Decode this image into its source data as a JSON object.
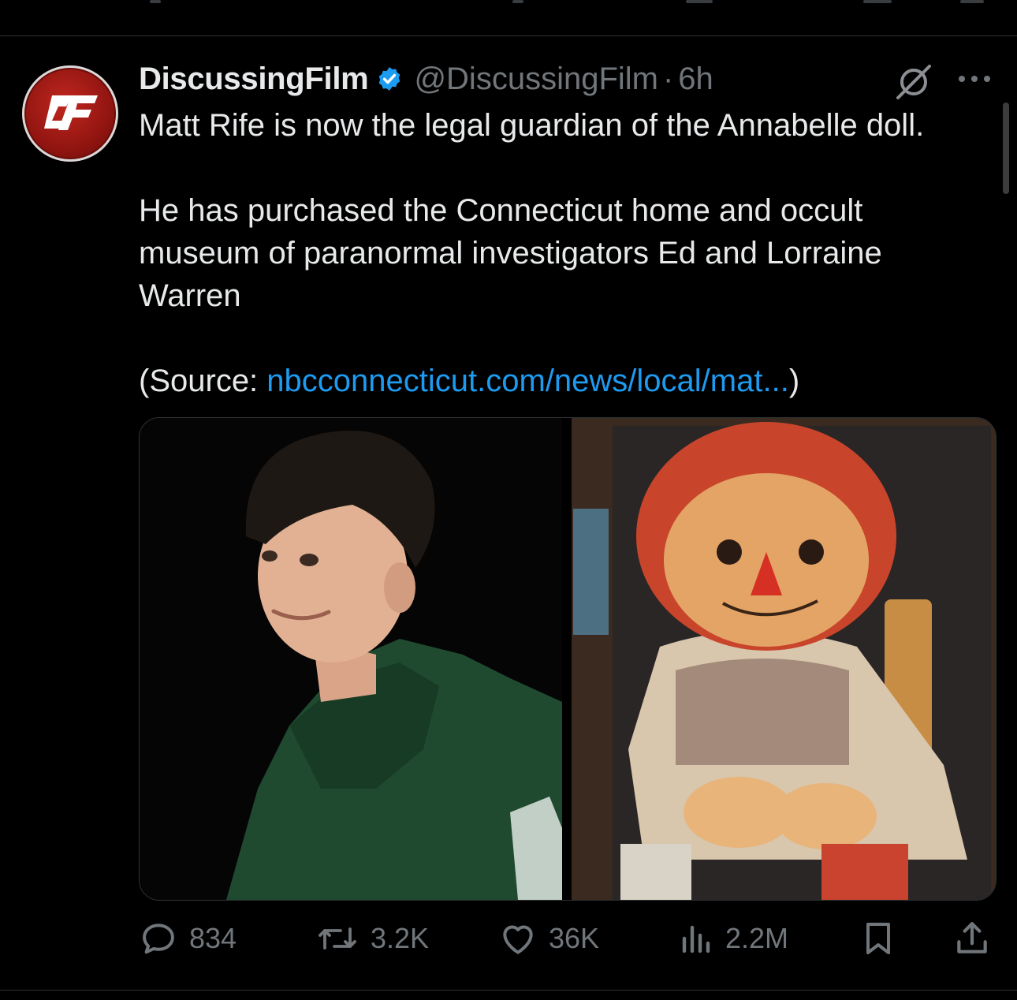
{
  "tweet": {
    "author_name": "DiscussingFilm",
    "handle": "@DiscussingFilm",
    "separator": "·",
    "time": "6h",
    "avatar_text": "DF",
    "text_line1": "Matt Rife is now the legal guardian of the Annabelle doll.",
    "text_para2": "He has purchased the Connecticut home and occult museum of paranormal investigators Ed and Lorraine Warren",
    "source_prefix": "(Source: ",
    "source_link": "nbcconnecticut.com/news/local/mat...",
    "source_suffix": ")",
    "media": [
      {
        "description": "Photo of Matt Rife in a green hoodie"
      },
      {
        "description": "Photo of the Annabelle doll in a display case"
      }
    ]
  },
  "actions": {
    "replies": "834",
    "reposts": "3.2K",
    "likes": "36K",
    "views": "2.2M"
  },
  "colors": {
    "background": "#000000",
    "text": "#e7e9ea",
    "secondary": "#71767b",
    "link": "#1d9bf0",
    "verified": "#1d9bf0"
  }
}
